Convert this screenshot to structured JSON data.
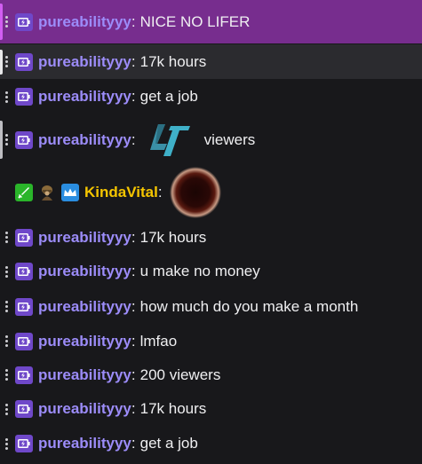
{
  "colors": {
    "background": "#18181b",
    "highlight_row": "#772d8e",
    "hover_row": "#2b2b2f",
    "username_purple": "#9c8cf9",
    "username_gold": "#f5c500",
    "badge_purple": "#6f48c9",
    "text": "#efeff1"
  },
  "messages": [
    {
      "user": "pureabilityyy",
      "colon": ":",
      "text": "NICE NO LIFER",
      "badge_icon": "battery-charging-icon"
    },
    {
      "user": "pureabilityyy",
      "colon": ":",
      "text": "17k hours",
      "badge_icon": "battery-charging-icon"
    },
    {
      "user": "pureabilityyy",
      "colon": ":",
      "text": "get a job",
      "badge_icon": "battery-charging-icon"
    },
    {
      "user": "pureabilityyy",
      "colon": ":",
      "text": "viewers",
      "badge_icon": "battery-charging-icon",
      "emote_icon": "teal-logo-emote-icon"
    },
    {
      "user": "KindaVital",
      "colon": ":",
      "text": "",
      "badge_icons": [
        "green-sword-badge-icon",
        "helmeted-figure-badge-icon",
        "blue-crown-badge-icon"
      ],
      "emote_icon": "dark-hole-emote-icon"
    },
    {
      "user": "pureabilityyy",
      "colon": ":",
      "text": "17k hours",
      "badge_icon": "battery-charging-icon"
    },
    {
      "user": "pureabilityyy",
      "colon": ":",
      "text": "u make no money",
      "badge_icon": "battery-charging-icon"
    },
    {
      "user": "pureabilityyy",
      "colon": ":",
      "text": "how much do you make a month",
      "badge_icon": "battery-charging-icon"
    },
    {
      "user": "pureabilityyy",
      "colon": ":",
      "text": "lmfao",
      "badge_icon": "battery-charging-icon"
    },
    {
      "user": "pureabilityyy",
      "colon": ":",
      "text": "200 viewers",
      "badge_icon": "battery-charging-icon"
    },
    {
      "user": "pureabilityyy",
      "colon": ":",
      "text": "17k hours",
      "badge_icon": "battery-charging-icon"
    },
    {
      "user": "pureabilityyy",
      "colon": ":",
      "text": "get a job",
      "badge_icon": "battery-charging-icon"
    }
  ]
}
